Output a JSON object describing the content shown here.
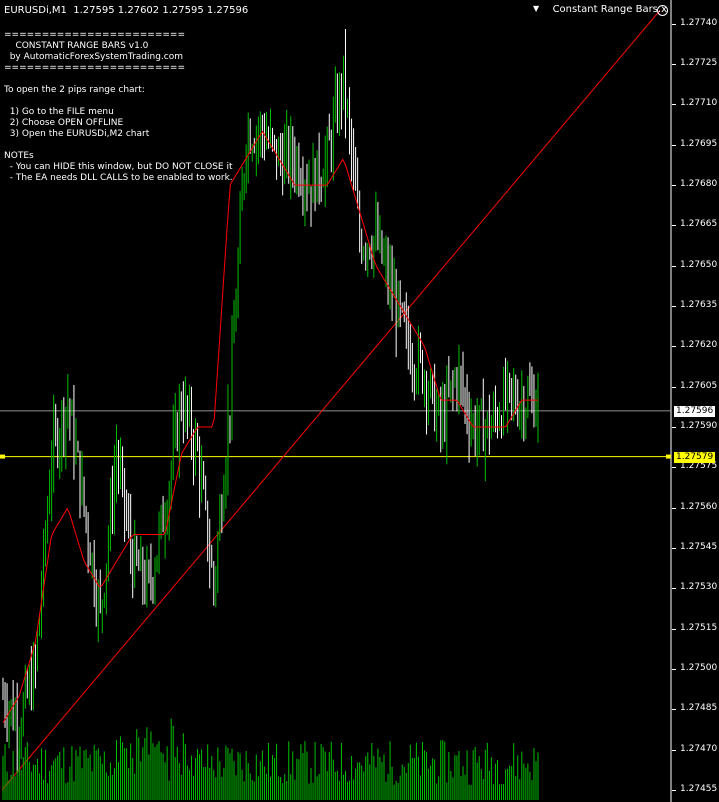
{
  "header": {
    "symbol_tf": "EURUSDi,M1",
    "ohlc": "1.27595 1.27602 1.27595 1.27596"
  },
  "ea_badge": {
    "label": "Constant Range Bars.x"
  },
  "info": {
    "lines": [
      "========================",
      "    CONSTANT RANGE BARS v1.0",
      "  by AutomaticForexSystemTrading.com",
      "========================",
      "",
      "To open the 2 pips range chart:",
      "",
      "  1) Go to the FILE menu",
      "  2) Choose OPEN OFFLINE",
      "  3) Open the EURUSDi,M2 chart",
      "",
      "NOTEs",
      "  - You can HIDE this window, but DO NOT CLOSE it",
      "  - The EA needs DLL CALLS to be enabled to work."
    ]
  },
  "price_scale": {
    "ticks": [
      "1.27740",
      "1.27725",
      "1.27710",
      "1.27695",
      "1.27680",
      "1.27665",
      "1.27650",
      "1.27635",
      "1.27620",
      "1.27605",
      "1.27590",
      "1.27575",
      "1.27560",
      "1.27545",
      "1.27530",
      "1.27515",
      "1.27500",
      "1.27485",
      "1.27470",
      "1.27455"
    ]
  },
  "current_price": {
    "label": "1.27596",
    "value": 1.27596
  },
  "hline": {
    "label": "1.27579",
    "value": 1.27579
  },
  "colors": {
    "bull": "#00c000",
    "bear": "#ffffff",
    "ma": "#ff0000",
    "trend": "#ff0000",
    "hline": "#ffff00",
    "bid": "#c0c0c0"
  },
  "chart_data": {
    "type": "candlestick",
    "symbol": "EURUSDi",
    "timeframe": "M1",
    "price_axis": [
      1.27452,
      1.27744
    ],
    "close_path": [
      1.2749,
      1.2748,
      1.275,
      1.2758,
      1.276,
      1.2756,
      1.2752,
      1.2758,
      1.2754,
      1.2753,
      1.2756,
      1.276,
      1.2758,
      1.2753,
      1.276,
      1.277,
      1.277,
      1.2769,
      1.2769,
      1.2768,
      1.2769,
      1.2772,
      1.2766,
      1.2766,
      1.2764,
      1.2762,
      1.2761,
      1.2759,
      1.2761,
      1.2759,
      1.2759,
      1.276,
      1.276,
      1.276
    ],
    "ma_path": [
      1.2748,
      1.2749,
      1.2751,
      1.2755,
      1.2756,
      1.2754,
      1.2753,
      1.2754,
      1.2755,
      1.2755,
      1.2755,
      1.2758,
      1.2759,
      1.2759,
      1.2768,
      1.2769,
      1.277,
      1.2769,
      1.2768,
      1.2768,
      1.2768,
      1.2769,
      1.2767,
      1.2765,
      1.2764,
      1.2763,
      1.2762,
      1.276,
      1.276,
      1.2759,
      1.2759,
      1.2759,
      1.276,
      1.276
    ],
    "trendline": {
      "from": [
        0,
        1.27455
      ],
      "to": [
        1,
        1.27745
      ]
    },
    "volume": "histogram"
  }
}
